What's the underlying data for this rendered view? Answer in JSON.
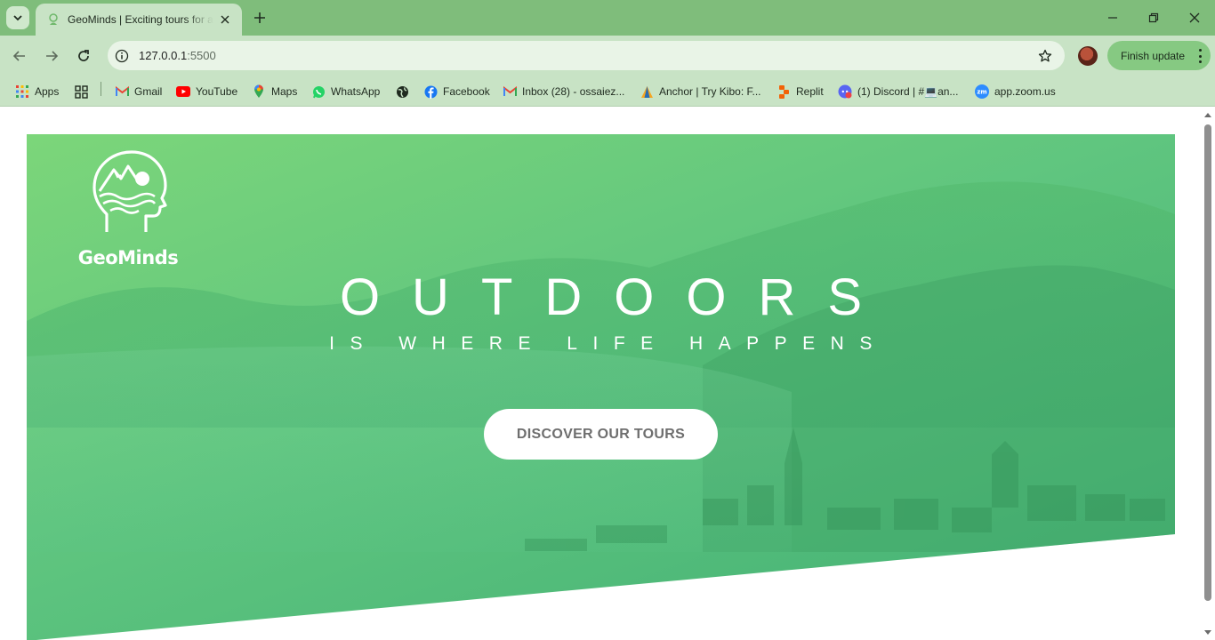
{
  "browser": {
    "tab_title": "GeoMinds | Exciting tours for adventurous people",
    "url_host": "127.0.0.1",
    "url_port": ":5500",
    "finish_update_label": "Finish update",
    "icons": {
      "tab_search": "chevron-down-icon",
      "tab_close": "close-icon",
      "new_tab": "plus-icon",
      "minimize": "minimize-icon",
      "restore": "restore-icon",
      "close_window": "close-icon",
      "back": "arrow-left-icon",
      "forward": "arrow-right-icon",
      "reload": "reload-icon",
      "site_info": "info-icon",
      "bookmark_star": "star-icon",
      "menu": "kebab-menu-icon"
    }
  },
  "bookmarks": [
    {
      "label": "Apps",
      "icon": "apps-grid-icon"
    },
    {
      "label": "",
      "icon": "tab-groups-icon"
    },
    {
      "label": "Gmail",
      "icon": "gmail-icon"
    },
    {
      "label": "YouTube",
      "icon": "youtube-icon"
    },
    {
      "label": "Maps",
      "icon": "maps-icon"
    },
    {
      "label": "WhatsApp",
      "icon": "whatsapp-icon"
    },
    {
      "label": "",
      "icon": "globe-icon"
    },
    {
      "label": "Facebook",
      "icon": "facebook-icon"
    },
    {
      "label": "Inbox (28) - ossaiez...",
      "icon": "gmail-icon"
    },
    {
      "label": "Anchor | Try Kibo: F...",
      "icon": "anchor-icon"
    },
    {
      "label": "Replit",
      "icon": "replit-icon"
    },
    {
      "label": "(1) Discord | #💻an...",
      "icon": "discord-icon"
    },
    {
      "label": "app.zoom.us",
      "icon": "zoom-icon"
    }
  ],
  "hero": {
    "logo_text": "GeoMinds",
    "title": "OUTDOORS",
    "subtitle": "IS WHERE LIFE HAPPENS",
    "cta_label": "DISCOVER OUR TOURS",
    "gradient_colors": [
      "#7cd67a",
      "#42b074"
    ]
  },
  "colors": {
    "tabstrip": "#7fbd7b",
    "toolbar": "#c8e3c5",
    "finish_update": "#86c982",
    "cta_text": "#6e6e6e"
  }
}
